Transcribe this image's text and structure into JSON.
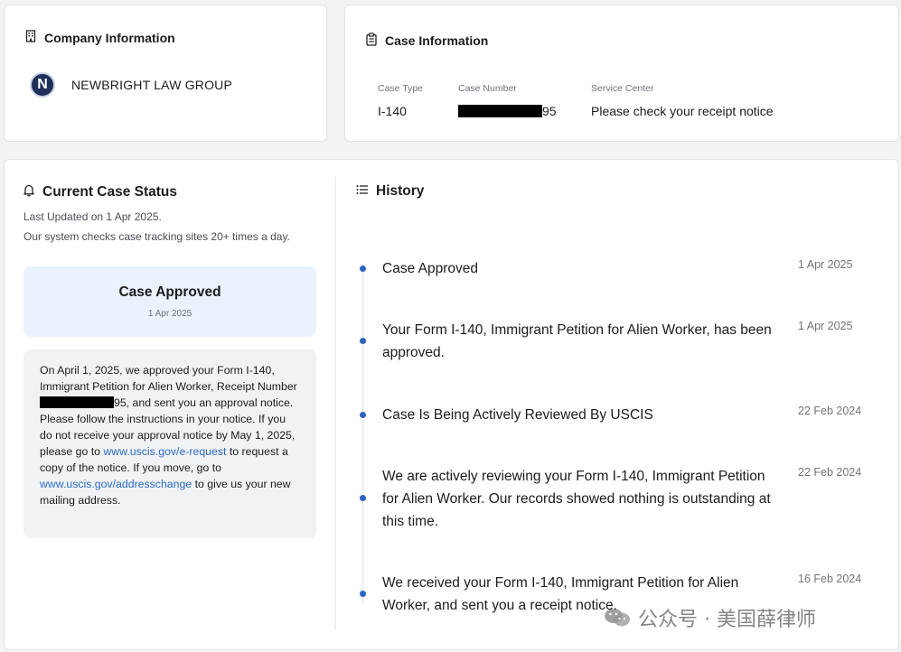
{
  "company": {
    "title": "Company Information",
    "logo_letter": "N",
    "name": "NEWBRIGHT LAW GROUP"
  },
  "case_info": {
    "title": "Case Information",
    "case_type_label": "Case Type",
    "case_type": "I-140",
    "case_number_label": "Case Number",
    "case_number_suffix": "95",
    "service_center_label": "Service Center",
    "service_center": "Please check your receipt notice"
  },
  "status": {
    "title": "Current Case Status",
    "last_updated": "Last Updated on 1 Apr 2025.",
    "checks_note": "Our system checks case tracking sites 20+ times a day.",
    "headline": "Case Approved",
    "headline_date": "1 Apr 2025",
    "desc_part1": "On April 1, 2025, we approved your Form I-140, Immigrant Petition for Alien Worker, Receipt Number ",
    "desc_part2": "95, and sent you an approval notice. Please follow the instructions in your notice. If you do not receive your approval notice by May 1, 2025, please go to ",
    "link1": "www.uscis.gov/e-request",
    "desc_part3": " to request a copy of the notice. If you move, go to ",
    "link2": "www.uscis.gov/addresschange",
    "desc_part4": " to give us your new mailing address."
  },
  "history": {
    "title": "History",
    "items": [
      {
        "text": "Case Approved",
        "date": "1 Apr 2025"
      },
      {
        "text": "Your Form I-140, Immigrant Petition for Alien Worker, has been approved.",
        "date": "1 Apr 2025"
      },
      {
        "text": "Case Is Being Actively Reviewed By USCIS",
        "date": "22 Feb 2024"
      },
      {
        "text": "We are actively reviewing your Form I-140, Immigrant Petition for Alien Worker. Our records showed nothing is outstanding at this time.",
        "date": "22 Feb 2024"
      },
      {
        "text": "We received your Form I-140, Immigrant Petition for Alien Worker, and sent you a receipt notice.",
        "date": "16 Feb 2024"
      }
    ]
  },
  "watermark": {
    "text": "公众号 · 美国薛律师"
  },
  "colors": {
    "accent": "#2c63c0",
    "link": "#2a6bc7",
    "approved_bg": "#eaf2fd"
  }
}
